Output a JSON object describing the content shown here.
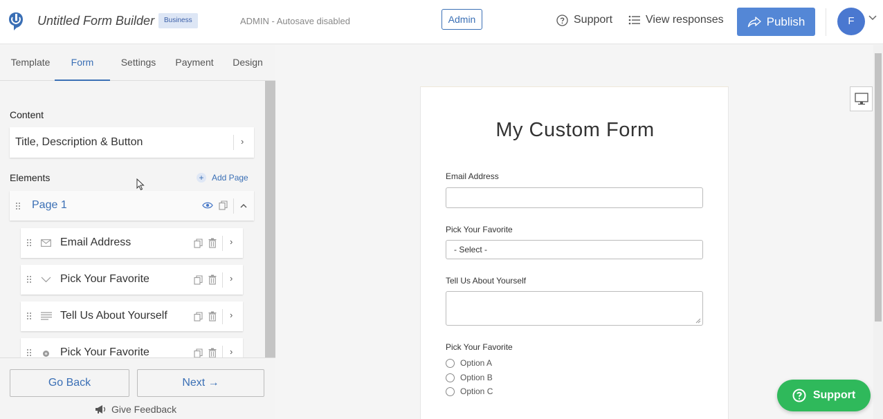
{
  "header": {
    "app_title": "Untitled Form Builder",
    "plan_badge": "Business",
    "autosave_status": "ADMIN - Autosave disabled",
    "admin_label": "Admin",
    "support_label": "Support",
    "view_responses_label": "View responses",
    "publish_label": "Publish",
    "avatar_initial": "F"
  },
  "tabs": [
    "Template",
    "Form",
    "Settings",
    "Payment",
    "Design"
  ],
  "active_tab": "Form",
  "sidebar": {
    "content_heading": "Content",
    "content_item": "Title, Description & Button",
    "elements_heading": "Elements",
    "add_page_label": "Add Page",
    "page_label": "Page 1",
    "elements": [
      {
        "label": "Email Address",
        "icon": "envelope-icon"
      },
      {
        "label": "Pick Your Favorite",
        "icon": "chevron-down-icon"
      },
      {
        "label": "Tell Us About Yourself",
        "icon": "paragraph-icon"
      },
      {
        "label": "Pick Your Favorite",
        "icon": "radio-icon"
      }
    ],
    "go_back_label": "Go Back",
    "next_label": "Next →",
    "feedback_label": "Give Feedback"
  },
  "form": {
    "title": "My Custom Form",
    "email_label": "Email Address",
    "email_value": "",
    "select_label": "Pick Your Favorite",
    "select_value": "- Select -",
    "textarea_label": "Tell Us About Yourself",
    "textarea_value": "",
    "radio_label": "Pick Your Favorite",
    "radio_options": [
      "Option A",
      "Option B",
      "Option C"
    ]
  },
  "support_float_label": "Support",
  "colors": {
    "accent": "#3a6fb5",
    "publish": "#5487d6",
    "support_green": "#2fb95b"
  }
}
